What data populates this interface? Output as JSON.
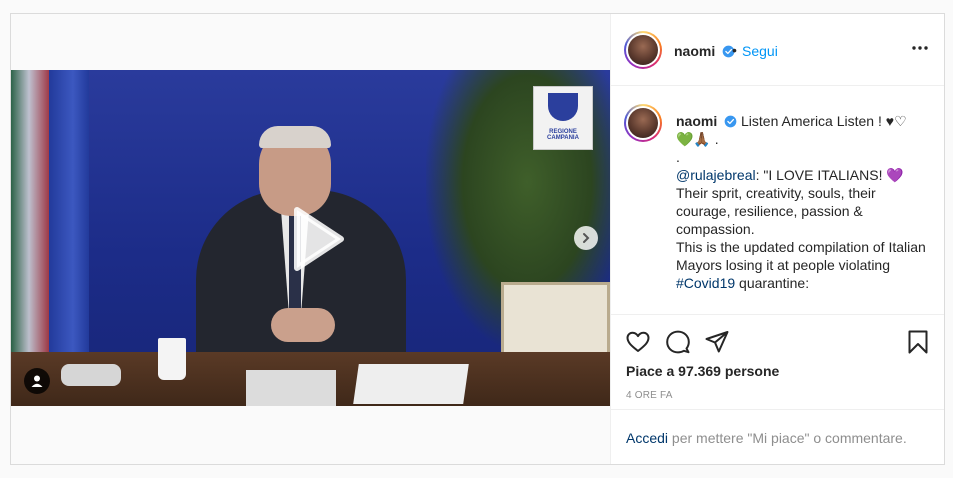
{
  "post": {
    "username": "naomi",
    "dot": "•",
    "follow_label": "Segui",
    "caption": {
      "line1": "Listen America Listen ! ♥♡",
      "line2": "💚🙏🏾 .",
      "line3": ".",
      "mention": "@rulajebreal",
      "quote": ": \"I LOVE ITALIANS! 💜",
      "body1": "Their sprit, creativity, souls, their courage, resilience, passion & compassion.",
      "body2": "This is the updated compilation of Italian Mayors losing it at people violating ",
      "hashtag": "#Covid19",
      "body3": " quarantine:"
    },
    "likes_text": "Piace a 97.369 persone",
    "time_text": "4 ORE FA",
    "login": {
      "link": "Accedi",
      "rest": " per mettere \"Mi piace\" o commentare."
    }
  },
  "media": {
    "emblem_text": "REGIONE CAMPANIA"
  },
  "colors": {
    "accent": "#0095f6",
    "link": "#00376b",
    "muted": "#8e8e8e",
    "border": "#dbdbdb"
  },
  "icons": {
    "play": "play-icon",
    "next": "chevron-right-icon",
    "user_tag": "user-tag-icon",
    "more": "more-horizontal-icon",
    "verified": "verified-badge-icon",
    "like": "heart-icon",
    "comment": "comment-icon",
    "share": "paper-plane-icon",
    "save": "bookmark-icon"
  }
}
